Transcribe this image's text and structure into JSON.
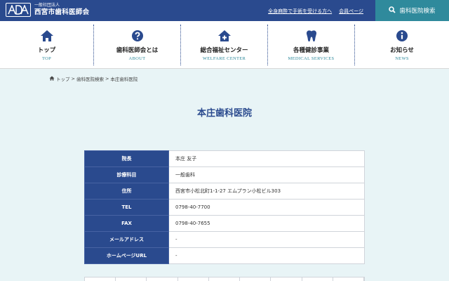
{
  "header": {
    "org_small": "一般社団法人",
    "org_name": "西宮市歯科医師会",
    "links": [
      "全身麻酔で手術を受ける方へ",
      "会員ページ"
    ],
    "search_label": "歯科医院検索"
  },
  "nav": {
    "items": [
      {
        "label": "トップ",
        "en": "TOP",
        "icon": "home-icon"
      },
      {
        "label": "歯科医師会とは",
        "en": "ABOUT",
        "icon": "question-icon"
      },
      {
        "label": "総合福祉センター",
        "en": "WELFARE CENTER",
        "icon": "welfare-house-icon"
      },
      {
        "label": "各種健診事業",
        "en": "MEDICAL SERVICES",
        "icon": "tooth-icon"
      },
      {
        "label": "お知らせ",
        "en": "NEWS",
        "icon": "info-icon"
      }
    ]
  },
  "breadcrumb": [
    "トップ",
    "歯科医院検索",
    "本庄歯科医院"
  ],
  "page_title": "本庄歯科医院",
  "clinic": {
    "rows": [
      {
        "label": "院長",
        "value": "本庄 友子"
      },
      {
        "label": "診療科目",
        "value": "一般歯科"
      },
      {
        "label": "住所",
        "value": "西宮市小松北町1-1-27 エムプラン小松ビル303"
      },
      {
        "label": "TEL",
        "value": "0798-40-7700"
      },
      {
        "label": "FAX",
        "value": "0798-40-7655"
      },
      {
        "label": "メールアドレス",
        "value": "-"
      },
      {
        "label": "ホームページURL",
        "value": "-"
      }
    ]
  },
  "colors": {
    "brand": "#2a4a8e",
    "accent": "#2f8a9c",
    "background": "#e8f4f6"
  }
}
